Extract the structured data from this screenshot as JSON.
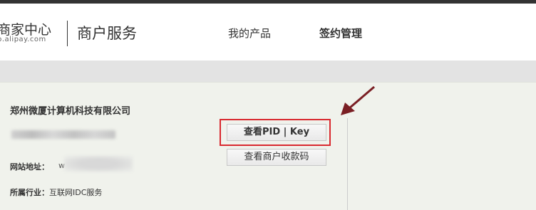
{
  "header": {
    "brand_cn": "商家中心",
    "brand_en": "b.alipay.com",
    "service_title": "商户服务",
    "nav": {
      "products": "我的产品",
      "contract": "签约管理"
    }
  },
  "merchant": {
    "company_name": "郑州微厦计算机科技有限公司",
    "website_label": "网站地址：",
    "website_prefix": "w",
    "industry_label": "所属行业：",
    "industry_value": "互联网IDC服务"
  },
  "actions": {
    "view_pid_key": "查看PID | Key",
    "view_qr_code": "查看商户收款码"
  },
  "colors": {
    "highlight": "#d9292f",
    "arrow": "#7a1f24",
    "panel_bg": "#f0f2ec"
  }
}
